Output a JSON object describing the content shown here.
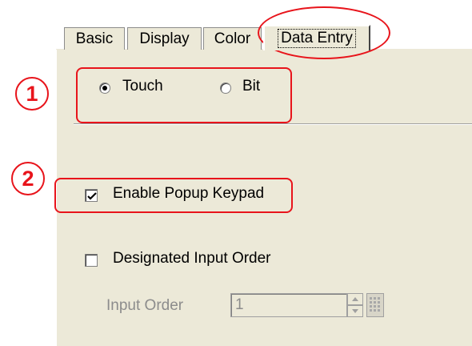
{
  "tabs": [
    {
      "label": "Basic",
      "active": false
    },
    {
      "label": "Display",
      "active": false
    },
    {
      "label": "Color",
      "active": false
    },
    {
      "label": "Data Entry",
      "active": true
    }
  ],
  "trigger": {
    "options": [
      {
        "label": "Touch",
        "selected": true
      },
      {
        "label": "Bit",
        "selected": false
      }
    ]
  },
  "popup_keypad": {
    "label": "Enable Popup Keypad",
    "checked": true
  },
  "designated_order": {
    "label": "Designated Input Order",
    "checked": false
  },
  "input_order": {
    "label": "Input Order",
    "value": "1",
    "enabled": false
  },
  "annotations": {
    "one": "1",
    "two": "2",
    "color": "#e8141b"
  }
}
